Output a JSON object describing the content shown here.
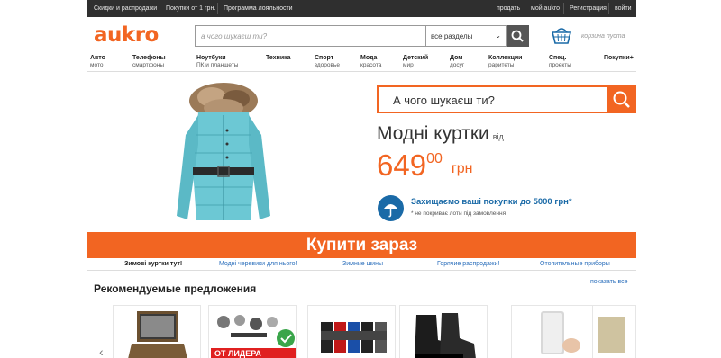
{
  "topnav": {
    "left": [
      "Скидки и распродажи",
      "Покупки от 1 грн.",
      "Программа лояльности"
    ],
    "right": [
      "продать",
      "мой aukro",
      "Регистрация",
      "войти"
    ]
  },
  "header": {
    "logo": "aukro",
    "search_placeholder": "а чого шукаєш ти?",
    "category_select": "все разделы",
    "cart_text": "корзина пуста"
  },
  "categories": [
    {
      "main": "Авто",
      "sub": "мото"
    },
    {
      "main": "Телефоны",
      "sub": "смартфоны"
    },
    {
      "main": "Ноутбуки",
      "sub": "ПК и планшеты"
    },
    {
      "main": "Техника",
      "sub": ""
    },
    {
      "main": "Спорт",
      "sub": "здоровье"
    },
    {
      "main": "Мода",
      "sub": "красота"
    },
    {
      "main": "Детский",
      "sub": "мир"
    },
    {
      "main": "Дом",
      "sub": "досуг"
    },
    {
      "main": "Коллекции",
      "sub": "раритеты"
    },
    {
      "main": "Спец.",
      "sub": "проекты"
    },
    {
      "main": "Покупки+",
      "sub": ""
    }
  ],
  "hero": {
    "search_text": "А чого шукаєш ти?",
    "title": "Модні куртки",
    "title_suffix": "від",
    "price_main": "649",
    "price_cents": "00",
    "currency": "грн",
    "protect_text": "Захищаємо ваші покупки до 5000 грн*",
    "protect_note": "* не покриває лоти під замовлення",
    "buy_button": "Купити зараз"
  },
  "promo_tabs": [
    {
      "label": "Зимові куртки тут!",
      "active": true
    },
    {
      "label": "Модні черевики для нього!",
      "active": false
    },
    {
      "label": "Зимние шины",
      "active": false
    },
    {
      "label": "Горячие распродажи!",
      "active": false
    },
    {
      "label": "Отопительные приборы",
      "active": false
    }
  ],
  "recommended": {
    "title": "Рекомендуемые предложения",
    "show_all": "показать все",
    "product_banner_text": "ОТ ЛИДЕРА"
  },
  "colors": {
    "accent": "#f26522",
    "topbar": "#2f2f2f",
    "link": "#2a6ebb",
    "shield": "#1a6aa7"
  }
}
